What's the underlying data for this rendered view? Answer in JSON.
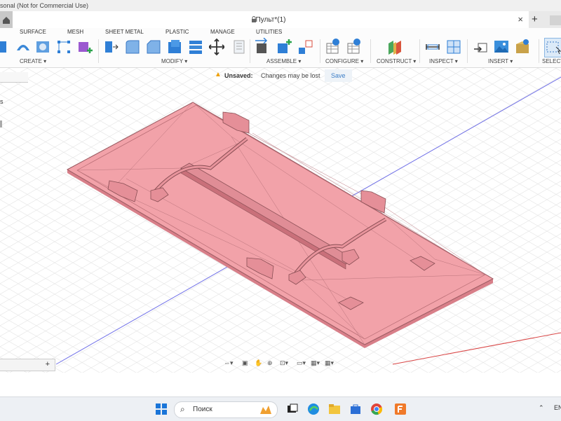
{
  "window": {
    "title": "sonal (Not for Commercial Use)"
  },
  "tabbar": {
    "doc_title": "Пульт*(1)",
    "close": "×",
    "add": "+"
  },
  "workspace_tabs": [
    "SURFACE",
    "MESH",
    "SHEET METAL",
    "PLASTIC",
    "MANAGE",
    "UTILITIES"
  ],
  "toolbar_groups": [
    "CREATE ▾",
    "MODIFY ▾",
    "ASSEMBLE ▾",
    "CONFIGURE ▾",
    "CONSTRUCT ▾",
    "INSPECT ▾",
    "INSERT ▾",
    "SELECT"
  ],
  "unsaved": {
    "label": "Unsaved:",
    "message": "Changes may be lost",
    "save": "Save"
  },
  "browser": {
    "side_letter_1": "s"
  },
  "comments": {
    "add": "+"
  },
  "taskbar": {
    "search_placeholder": "Поиск",
    "language": "EN"
  },
  "colors": {
    "model": "#f2a0a6",
    "model_edge": "#8a4f55",
    "accent_blue": "#1a75d8"
  },
  "icons": [
    "home-icon",
    "lock-icon",
    "search-icon",
    "windows-start-icon",
    "warning-icon"
  ]
}
